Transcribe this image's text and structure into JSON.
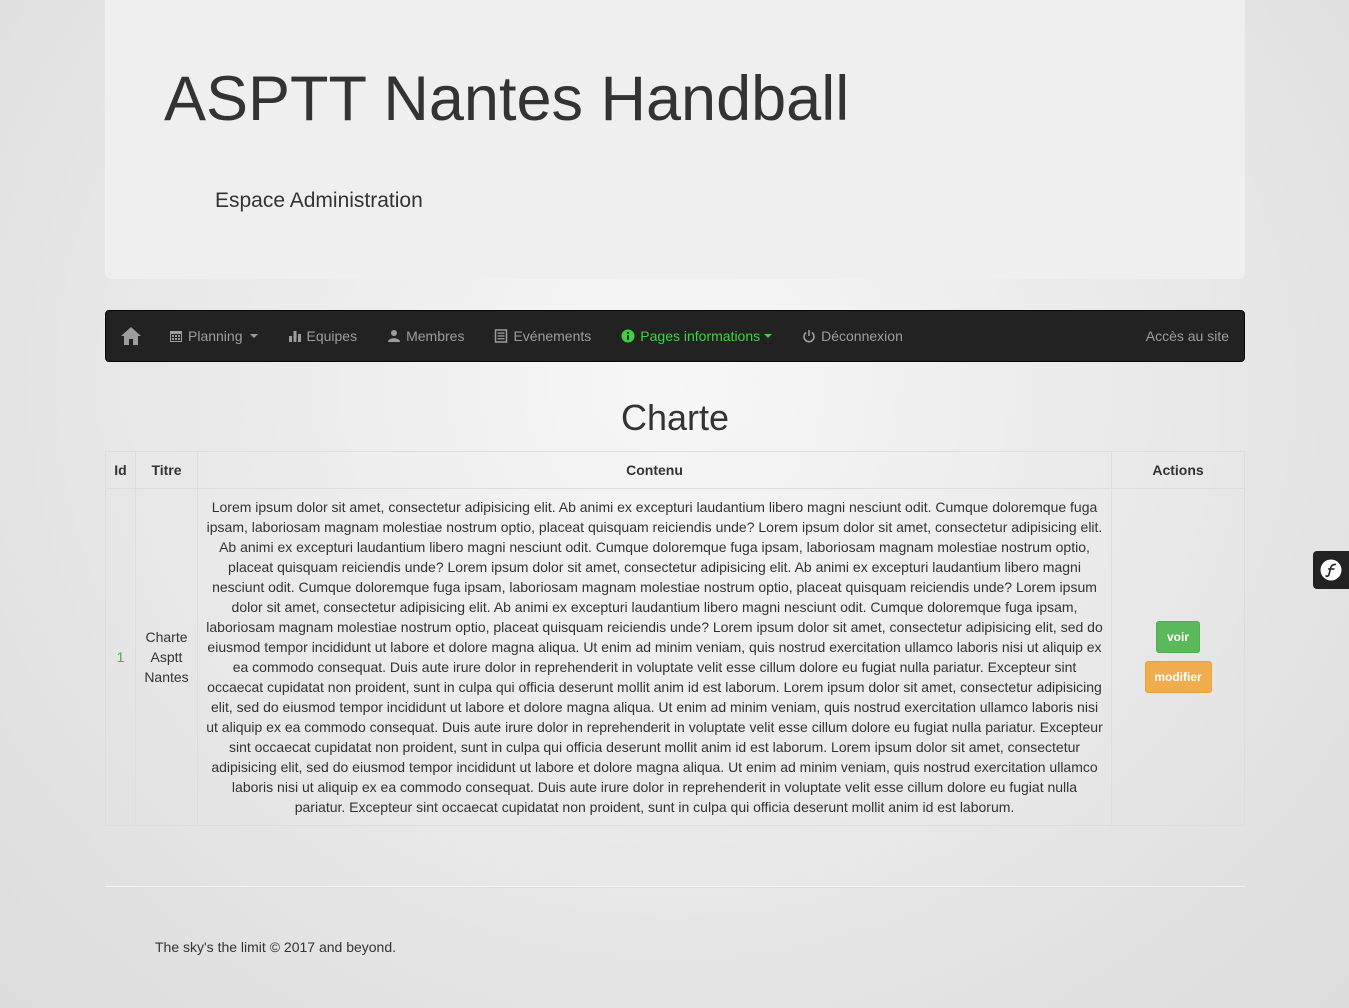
{
  "header": {
    "title": "ASPTT Nantes Handball",
    "subtitle": "Espace Administration"
  },
  "navbar": {
    "home_icon": "home-icon",
    "items": [
      {
        "label": "Planning",
        "icon": "calendar-icon",
        "dropdown": true
      },
      {
        "label": "Equipes",
        "icon": "stats-icon",
        "dropdown": false
      },
      {
        "label": "Membres",
        "icon": "user-icon",
        "dropdown": false
      },
      {
        "label": "Evénements",
        "icon": "list-icon",
        "dropdown": false
      },
      {
        "label": "Pages informations",
        "icon": "info-icon",
        "dropdown": true,
        "active": true
      },
      {
        "label": "Déconnexion",
        "icon": "power-icon",
        "dropdown": false
      }
    ],
    "right_link": "Accès au site",
    "active_color": "#3fd23f",
    "background_color": "#222222"
  },
  "page": {
    "heading": "Charte"
  },
  "table": {
    "columns": [
      "Id",
      "Titre",
      "Contenu",
      "Actions"
    ],
    "rows": [
      {
        "id": "1",
        "titre": "Charte Asptt Nantes",
        "contenu": "Lorem ipsum dolor sit amet, consectetur adipisicing elit. Ab animi ex excepturi laudantium libero magni nesciunt odit. Cumque doloremque fuga ipsam, laboriosam magnam molestiae nostrum optio, placeat quisquam reiciendis unde? Lorem ipsum dolor sit amet, consectetur adipisicing elit. Ab animi ex excepturi laudantium libero magni nesciunt odit. Cumque doloremque fuga ipsam, laboriosam magnam molestiae nostrum optio, placeat quisquam reiciendis unde? Lorem ipsum dolor sit amet, consectetur adipisicing elit. Ab animi ex excepturi laudantium libero magni nesciunt odit. Cumque doloremque fuga ipsam, laboriosam magnam molestiae nostrum optio, placeat quisquam reiciendis unde? Lorem ipsum dolor sit amet, consectetur adipisicing elit. Ab animi ex excepturi laudantium libero magni nesciunt odit. Cumque doloremque fuga ipsam, laboriosam magnam molestiae nostrum optio, placeat quisquam reiciendis unde? Lorem ipsum dolor sit amet, consectetur adipisicing elit, sed do eiusmod tempor incididunt ut labore et dolore magna aliqua. Ut enim ad minim veniam, quis nostrud exercitation ullamco laboris nisi ut aliquip ex ea commodo consequat. Duis aute irure dolor in reprehenderit in voluptate velit esse cillum dolore eu fugiat nulla pariatur. Excepteur sint occaecat cupidatat non proident, sunt in culpa qui officia deserunt mollit anim id est laborum. Lorem ipsum dolor sit amet, consectetur adipisicing elit, sed do eiusmod tempor incididunt ut labore et dolore magna aliqua. Ut enim ad minim veniam, quis nostrud exercitation ullamco laboris nisi ut aliquip ex ea commodo consequat. Duis aute irure dolor in reprehenderit in voluptate velit esse cillum dolore eu fugiat nulla pariatur. Excepteur sint occaecat cupidatat non proident, sunt in culpa qui officia deserunt mollit anim id est laborum. Lorem ipsum dolor sit amet, consectetur adipisicing elit, sed do eiusmod tempor incididunt ut labore et dolore magna aliqua. Ut enim ad minim veniam, quis nostrud exercitation ullamco laboris nisi ut aliquip ex ea commodo consequat. Duis aute irure dolor in reprehenderit in voluptate velit esse cillum dolore eu fugiat nulla pariatur. Excepteur sint occaecat cupidatat non proident, sunt in culpa qui officia deserunt mollit anim id est laborum.",
        "actions": {
          "view_label": "voir",
          "edit_label": "modifier"
        }
      }
    ]
  },
  "colors": {
    "view_button": "#5cb85c",
    "edit_button": "#f0ad4e",
    "id_link": "#3fb04f"
  },
  "footer": {
    "text": "The sky's the limit © 2017 and beyond."
  },
  "debug_toolbar": {
    "icon": "symfony-logo-icon"
  }
}
